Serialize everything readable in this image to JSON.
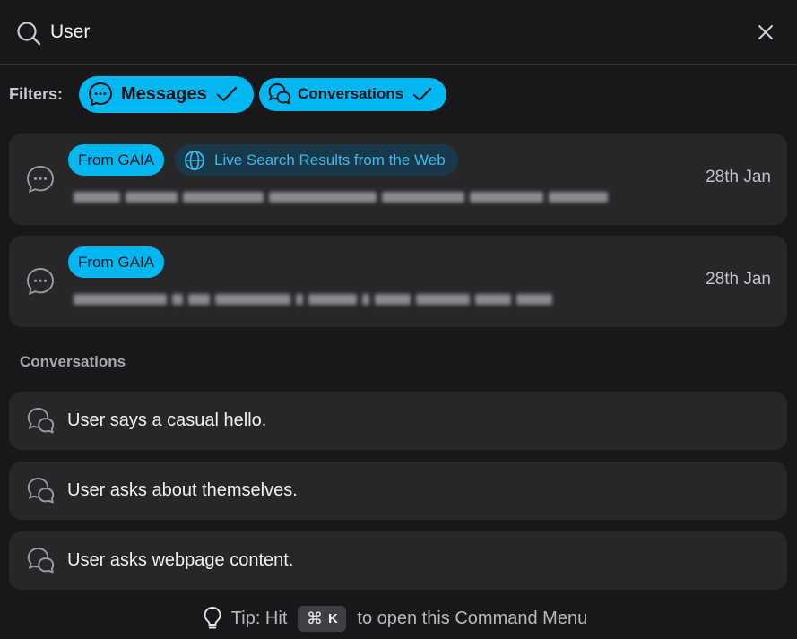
{
  "search": {
    "query": "User",
    "icon": "search-icon",
    "close_icon": "close-icon"
  },
  "filters": {
    "label": "Filters:",
    "chips": [
      {
        "label": "Messages",
        "icon": "message-bubble-icon",
        "selected": true
      },
      {
        "label": "Conversations",
        "icon": "conversations-icon",
        "selected": true
      }
    ]
  },
  "results": [
    {
      "icon": "message-bubble-icon",
      "tag_source": "From GAIA",
      "tag_web": "Live Search Results from the Web",
      "date": "28th Jan",
      "snippet_redacted": true
    },
    {
      "icon": "message-bubble-icon",
      "tag_source": "From GAIA",
      "date": "28th Jan",
      "snippet_redacted": true
    }
  ],
  "conversations_section": {
    "title": "Conversations",
    "items": [
      {
        "title": "User says a casual hello.",
        "icon": "conversation-icon"
      },
      {
        "title": "User asks about themselves.",
        "icon": "conversation-icon"
      },
      {
        "title": "User asks webpage content.",
        "icon": "conversation-icon"
      }
    ]
  },
  "tip": {
    "prefix": "Tip: Hit",
    "key_symbol": "⌘",
    "key_letter": "K",
    "suffix": "to open this Command Menu",
    "icon": "lightbulb-icon"
  },
  "colors": {
    "background": "#18181a",
    "card": "#27272a",
    "accent": "#00b7f1",
    "web_tag_bg": "#17394a",
    "web_tag_text": "#3fb6ec"
  }
}
